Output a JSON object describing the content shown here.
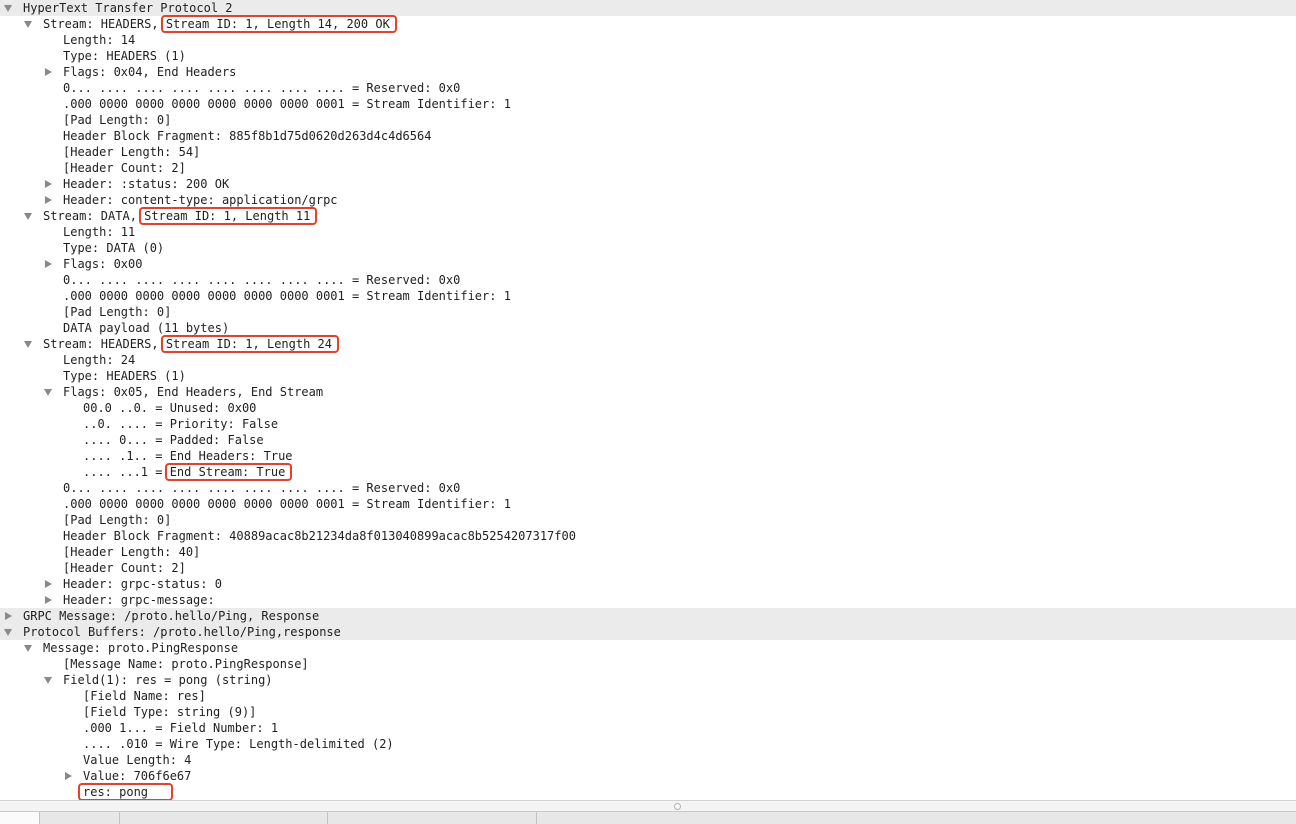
{
  "colors": {
    "highlight_box": "#e2412c",
    "section_row_background": "#ebebeb",
    "text": "#1f1f1f",
    "disclosure_triangle": "#8a8a8a"
  },
  "icons": {
    "expanded": "triangle-down-icon",
    "collapsed": "triangle-right-icon",
    "splitter": "splitter-handle-icon"
  },
  "tree": {
    "http2": {
      "label": "HyperText Transfer Protocol 2",
      "expanded": true,
      "streams": [
        {
          "label": "Stream: HEADERS, ",
          "highlight": "Stream ID: 1, Length 14, 200 OK",
          "expanded": true,
          "fields": [
            {
              "label": "Length: 14"
            },
            {
              "label": "Type: HEADERS (1)"
            },
            {
              "label": "Flags: 0x04, End Headers",
              "expanded": false
            },
            {
              "label": "0... .... .... .... .... .... .... .... = Reserved: 0x0"
            },
            {
              "label": ".000 0000 0000 0000 0000 0000 0000 0001 = Stream Identifier: 1"
            },
            {
              "label": "[Pad Length: 0]"
            },
            {
              "label": "Header Block Fragment: 885f8b1d75d0620d263d4c4d6564"
            },
            {
              "label": "[Header Length: 54]"
            },
            {
              "label": "[Header Count: 2]"
            },
            {
              "label": "Header: :status: 200 OK",
              "expanded": false
            },
            {
              "label": "Header: content-type: application/grpc",
              "expanded": false
            }
          ]
        },
        {
          "label": "Stream: DATA, ",
          "highlight": "Stream ID: 1, Length 11",
          "expanded": true,
          "fields": [
            {
              "label": "Length: 11"
            },
            {
              "label": "Type: DATA (0)"
            },
            {
              "label": "Flags: 0x00",
              "expanded": false
            },
            {
              "label": "0... .... .... .... .... .... .... .... = Reserved: 0x0"
            },
            {
              "label": ".000 0000 0000 0000 0000 0000 0000 0001 = Stream Identifier: 1"
            },
            {
              "label": "[Pad Length: 0]"
            },
            {
              "label": "DATA payload (11 bytes)"
            }
          ]
        },
        {
          "label": "Stream: HEADERS, ",
          "highlight": "Stream ID: 1, Length 24",
          "expanded": true,
          "fields": [
            {
              "label": "Length: 24"
            },
            {
              "label": "Type: HEADERS (1)"
            },
            {
              "label": "Flags: 0x05, End Headers, End Stream",
              "expanded": true,
              "bits": [
                {
                  "label": "00.0 ..0. = Unused: 0x00"
                },
                {
                  "label": "..0. .... = Priority: False"
                },
                {
                  "label": ".... 0... = Padded: False"
                },
                {
                  "label": ".... .1.. = End Headers: True"
                },
                {
                  "label": ".... ...1 = ",
                  "highlight": "End Stream: True"
                }
              ]
            },
            {
              "label": "0... .... .... .... .... .... .... .... = Reserved: 0x0"
            },
            {
              "label": ".000 0000 0000 0000 0000 0000 0000 0001 = Stream Identifier: 1"
            },
            {
              "label": "[Pad Length: 0]"
            },
            {
              "label": "Header Block Fragment: 40889acac8b21234da8f013040899acac8b5254207317f00"
            },
            {
              "label": "[Header Length: 40]"
            },
            {
              "label": "[Header Count: 2]"
            },
            {
              "label": "Header: grpc-status: 0",
              "expanded": false
            },
            {
              "label": "Header: grpc-message:",
              "expanded": false
            }
          ]
        }
      ]
    },
    "grpc": {
      "label": "GRPC Message: /proto.hello/Ping, Response",
      "expanded": false
    },
    "protobuf": {
      "label": "Protocol Buffers: /proto.hello/Ping,response",
      "expanded": true,
      "message": {
        "label": "Message: proto.PingResponse",
        "expanded": true,
        "fields": [
          {
            "label": "[Message Name: proto.PingResponse]"
          },
          {
            "label": "Field(1): res = pong (string)",
            "expanded": true,
            "fields": [
              {
                "label": "[Field Name: res]"
              },
              {
                "label": "[Field Type: string (9)]"
              },
              {
                "label": ".000 1... = Field Number: 1"
              },
              {
                "label": ".... .010 = Wire Type: Length-delimited (2)"
              },
              {
                "label": "Value Length: 4"
              },
              {
                "label": "Value: 706f6e67",
                "expanded": false
              },
              {
                "highlight": "res: pong"
              }
            ]
          }
        ]
      }
    }
  }
}
